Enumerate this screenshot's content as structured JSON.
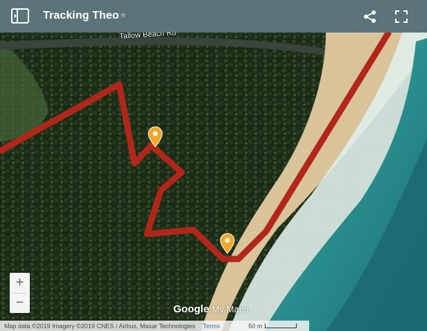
{
  "header": {
    "title": "Tracking Theo",
    "star_icon": "star-icon",
    "legend_icon": "map-legend-icon",
    "share_icon": "share-icon",
    "fullscreen_icon": "fullscreen-icon"
  },
  "map": {
    "road_label": "Tallow Beach Rd",
    "route_color": "#b3261a",
    "marker_color": "#f4a629",
    "markers": 2
  },
  "zoom": {
    "in_label": "+",
    "out_label": "−"
  },
  "branding": {
    "google": "Google",
    "my_maps": "My Maps"
  },
  "footer": {
    "attribution": "Map data ©2019 Imagery ©2019 CNES / Airbus, Maxar Technologies",
    "terms": "Terms",
    "scale": "50 m"
  }
}
